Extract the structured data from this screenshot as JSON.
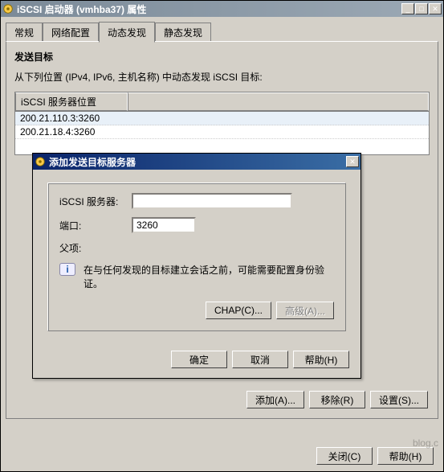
{
  "mainWindow": {
    "title": "iSCSI 启动器 (vmhba37) 属性",
    "tabs": {
      "general": "常规",
      "network": "网络配置",
      "dynamic": "动态发现",
      "static": "静态发现"
    },
    "section": {
      "heading": "发送目标",
      "hint": "从下列位置 (IPv4, IPv6, 主机名称) 中动态发现 iSCSI 目标:"
    },
    "list": {
      "header": "iSCSI 服务器位置",
      "rows": [
        "200.21.110.3:3260",
        "200.21.18.4:3260"
      ]
    },
    "bottomButtons": {
      "add": "添加(A)...",
      "remove": "移除(R)",
      "settings": "设置(S)..."
    },
    "footerButtons": {
      "close": "关闭(C)",
      "help": "帮助(H)"
    }
  },
  "modal": {
    "title": "添加发送目标服务器",
    "fields": {
      "serverLabel": "iSCSI 服务器:",
      "serverValue": "",
      "portLabel": "端口:",
      "portValue": "3260",
      "parentLabel": "父项:"
    },
    "infoText": "在与任何发现的目标建立会话之前，可能需要配置身份验证。",
    "groupButtons": {
      "chap": "CHAP(C)...",
      "advanced": "高级(A)..."
    },
    "buttons": {
      "ok": "确定",
      "cancel": "取消",
      "help": "帮助(H)"
    }
  },
  "watermark": "blog.c"
}
